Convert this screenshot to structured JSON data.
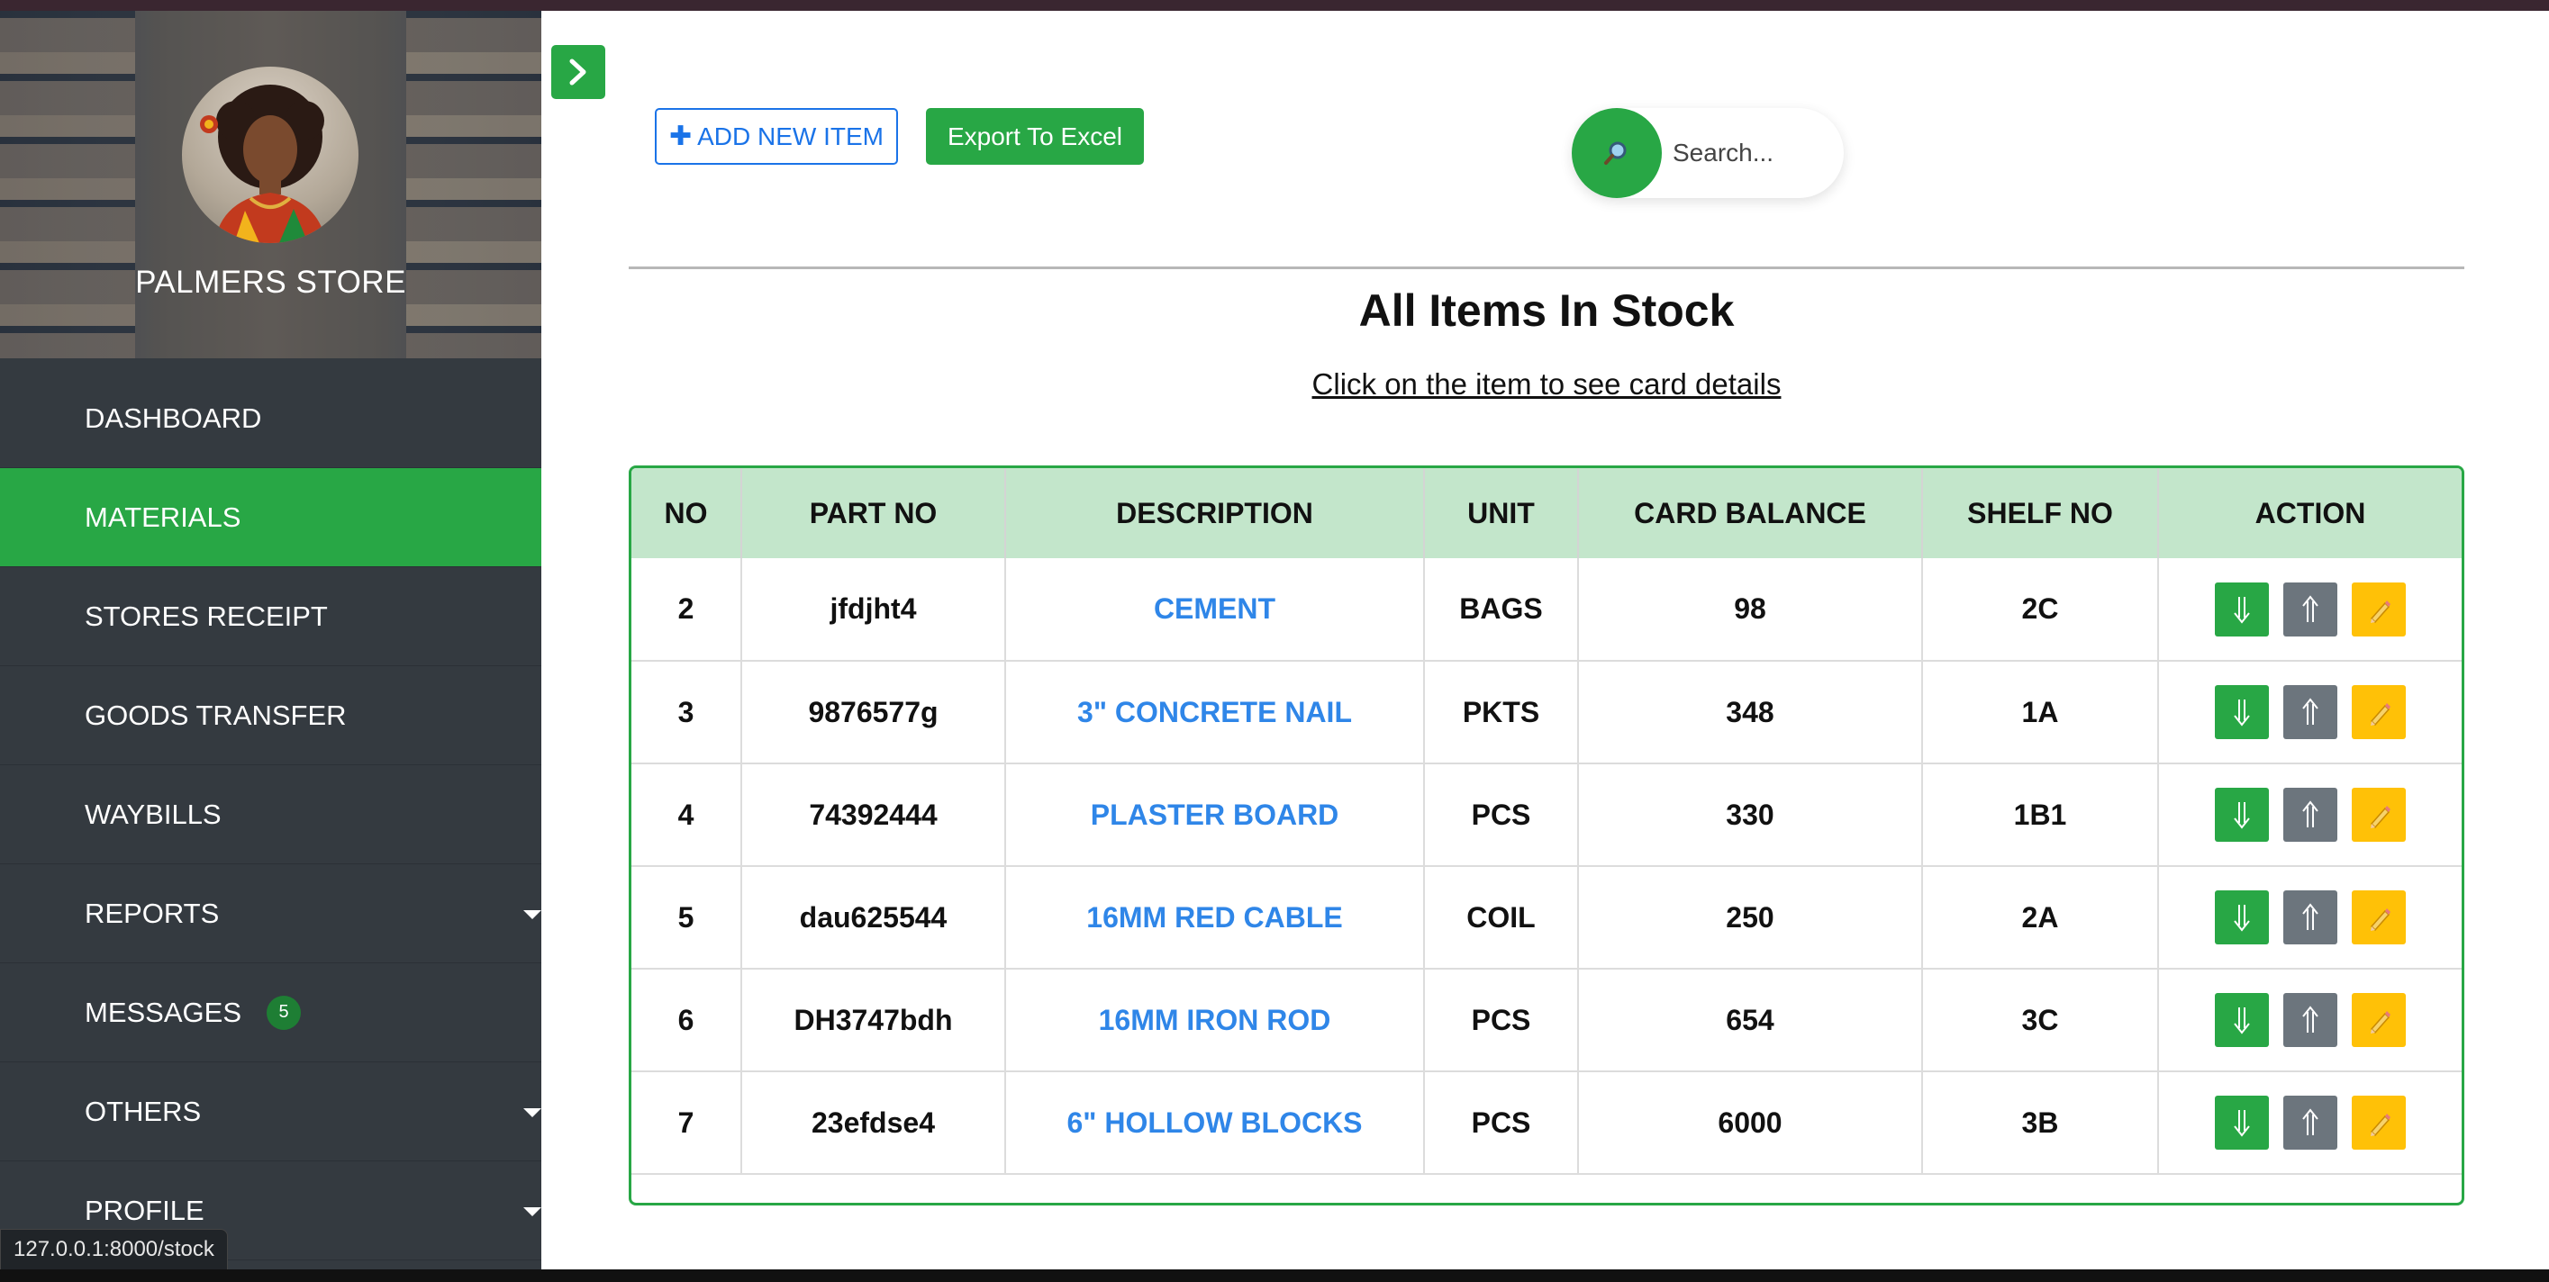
{
  "sidebar": {
    "store_name": "PALMERS STORE",
    "items": [
      {
        "label": "DASHBOARD"
      },
      {
        "label": "MATERIALS"
      },
      {
        "label": "STORES RECEIPT"
      },
      {
        "label": "GOODS TRANSFER"
      },
      {
        "label": "WAYBILLS"
      },
      {
        "label": "REPORTS"
      },
      {
        "label": "MESSAGES",
        "badge": "5"
      },
      {
        "label": "OTHERS"
      },
      {
        "label": "PROFILE"
      }
    ],
    "active": "MATERIALS"
  },
  "status_url": "127.0.0.1:8000/stock",
  "toolbar": {
    "add_label": "ADD NEW ITEM",
    "export_label": "Export To Excel"
  },
  "search": {
    "placeholder": "Search...",
    "icon": "magnifier-icon"
  },
  "main": {
    "title": "All Items In Stock",
    "subtitle": "Click on the item to see card details"
  },
  "table": {
    "headers": [
      "NO",
      "PART NO",
      "DESCRIPTION",
      "UNIT",
      "CARD BALANCE",
      "SHELF NO",
      "ACTION"
    ],
    "rows": [
      {
        "no": "2",
        "part_no": "jfdjht4",
        "description": "CEMENT",
        "unit": "BAGS",
        "balance": "98",
        "shelf": "2C"
      },
      {
        "no": "3",
        "part_no": "9876577g",
        "description": "3\" CONCRETE NAIL",
        "unit": "PKTS",
        "balance": "348",
        "shelf": "1A"
      },
      {
        "no": "4",
        "part_no": "74392444",
        "description": "PLASTER BOARD",
        "unit": "PCS",
        "balance": "330",
        "shelf": "1B1"
      },
      {
        "no": "5",
        "part_no": "dau625544",
        "description": "16MM RED CABLE",
        "unit": "COIL",
        "balance": "250",
        "shelf": "2A"
      },
      {
        "no": "6",
        "part_no": "DH3747bdh",
        "description": "16MM IRON ROD",
        "unit": "PCS",
        "balance": "654",
        "shelf": "3C"
      },
      {
        "no": "7",
        "part_no": "23efdse4",
        "description": "6\" HOLLOW BLOCKS",
        "unit": "PCS",
        "balance": "6000",
        "shelf": "3B"
      }
    ]
  },
  "colors": {
    "accent_green": "#28a745",
    "header_green": "#c3e6cb",
    "link_blue": "#2f86e8",
    "sidebar_bg": "#343a40",
    "edit_yellow": "#ffc107",
    "gray": "#6c757d"
  }
}
